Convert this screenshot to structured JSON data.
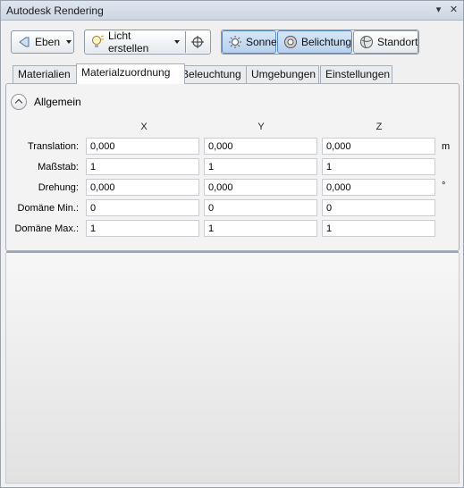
{
  "window": {
    "title": "Autodesk Rendering"
  },
  "toolbar": {
    "layers_label": "Eben",
    "create_light_label": "Licht erstellen",
    "sun_label": "Sonne",
    "exposure_label": "Belichtung",
    "location_label": "Standort"
  },
  "tabs": [
    "Materialien",
    "Materialzuordnung",
    "Beleuchtung",
    "Umgebungen",
    "Einstellungen"
  ],
  "section": {
    "title": "Allgemein"
  },
  "columns": [
    "X",
    "Y",
    "Z"
  ],
  "rows": [
    {
      "label": "Translation:",
      "values": [
        "0,000",
        "0,000",
        "0,000"
      ],
      "unit": "m"
    },
    {
      "label": "Maßstab:",
      "values": [
        "1",
        "1",
        "1"
      ],
      "unit": ""
    },
    {
      "label": "Drehung:",
      "values": [
        "0,000",
        "0,000",
        "0,000"
      ],
      "unit": "°"
    },
    {
      "label": "Domäne Min.:",
      "values": [
        "0",
        "0",
        "0"
      ],
      "unit": ""
    },
    {
      "label": "Domäne Max.:",
      "values": [
        "1",
        "1",
        "1"
      ],
      "unit": ""
    }
  ]
}
